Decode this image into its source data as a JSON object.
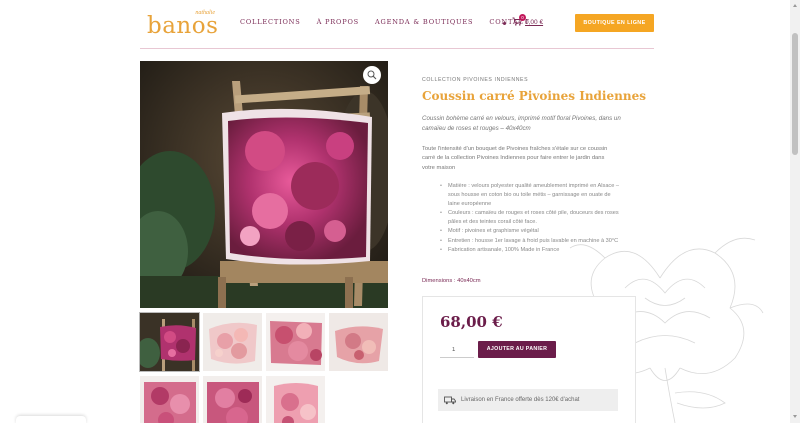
{
  "brand": {
    "small": "nathalie",
    "name": "banos",
    "color": "#e8a33a"
  },
  "nav": {
    "items": [
      {
        "label": "COLLECTIONS"
      },
      {
        "label": "À PROPOS"
      },
      {
        "label": "AGENDA & BOUTIQUES"
      },
      {
        "label": "CONTACT"
      }
    ],
    "cart_count": "0",
    "cart_total": "0,00 €",
    "shop_button": "BOUTIQUE EN LIGNE"
  },
  "product": {
    "category": "COLLECTION PIVOINES INDIENNES",
    "title": "Coussin carré Pivoines Indiennes",
    "short_description": "Coussin bohème carré en velours, imprimé motif floral Pivoines, dans un camaïeu de roses et rouges – 40x40cm",
    "description": "Toute l'intensité d'un bouquet de Pivoines fraîches s'étale sur ce coussin carré de la collection Pivoines Indiennes pour faire entrer le jardin dans votre maison",
    "features": [
      "Matière : velours polyester qualité ameublement imprimé en Alsace – sous housse en coton bio ou toile métis – garnissage en ouate de laine européenne",
      "Couleurs : camaïeu de rouges et roses côté pile, douceurs des roses pâles et des teintes corail côté face.",
      "Motif : pivoines et graphisme végétal",
      "Entretien : housse 1er lavage à froid puis lavable en machine à 30°C",
      "Fabrication artisanale, 100% Made in France"
    ],
    "dimensions": "Dimensions : 40x40cm",
    "price": "68,00 €",
    "quantity": "1",
    "add_to_cart": "AJOUTER AU PANIER",
    "shipping": "Livraison en France offerte dès 120€ d'achat"
  },
  "colors": {
    "accent": "#e8a33a",
    "plum": "#6b1d4a",
    "nav": "#7a2a55"
  }
}
